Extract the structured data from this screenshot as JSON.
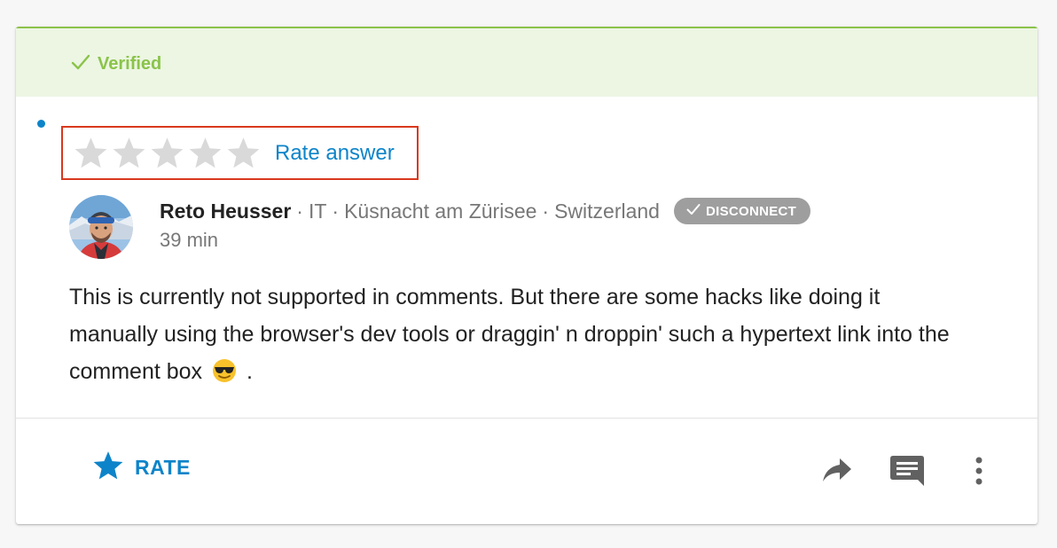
{
  "verified": {
    "label": "Verified",
    "icon": "checkmark-icon",
    "color": "#8bc34a",
    "background": "#ecf6e3"
  },
  "rating": {
    "stars": 5,
    "filled": 0,
    "star_color": "#d9d9d9",
    "rate_answer_label": "Rate answer",
    "highlight_color": "#d9381e"
  },
  "author": {
    "name": "Reto Heusser",
    "category": "IT",
    "city": "Küsnacht am Zürisee",
    "country": "Switzerland",
    "separator": "·",
    "badge_label": "DISCONNECT",
    "time": "39 min"
  },
  "comment": {
    "text_before": "This is currently not supported in comments. But there are some hacks like doing it manually using the browser's dev tools or draggin' n droppin' such a hypertext link into the comment box",
    "emoji": "smiling-face-with-sunglasses",
    "text_after": "."
  },
  "actions": {
    "rate_label": "RATE",
    "rate_icon": "star-icon",
    "share_icon": "share-icon",
    "comment_icon": "comment-icon",
    "more_icon": "more-vertical-icon"
  },
  "colors": {
    "accent": "#0d84c9",
    "unread_dot": "#0d84c9",
    "badge": "#9e9e9e",
    "icon_gray": "#616161"
  }
}
